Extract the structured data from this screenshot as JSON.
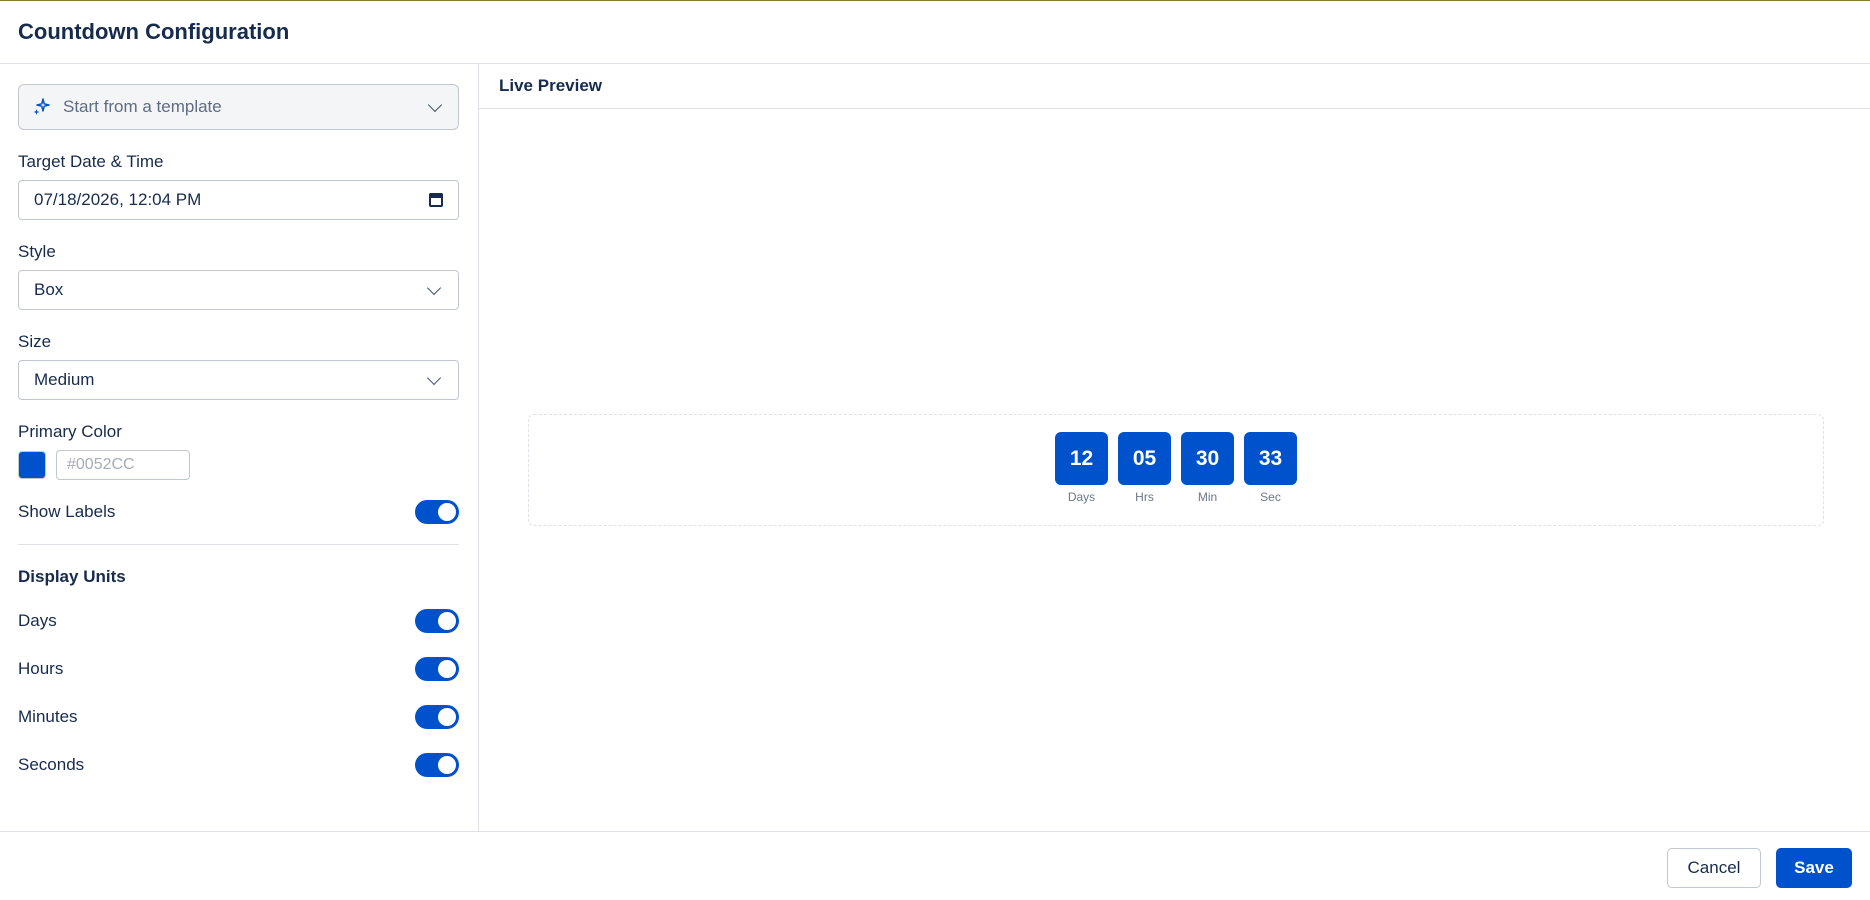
{
  "header": {
    "title": "Countdown Configuration"
  },
  "left": {
    "template_label": "Start from a template",
    "target_label": "Target Date & Time",
    "target_value": "07/18/2026, 12:04 PM",
    "style_label": "Style",
    "style_value": "Box",
    "size_label": "Size",
    "size_value": "Medium",
    "color_label": "Primary Color",
    "color_value": "#0052CC",
    "color_placeholder": "#0052CC",
    "show_labels": "Show Labels",
    "display_units_title": "Display Units",
    "units": [
      {
        "label": "Days",
        "enabled": true
      },
      {
        "label": "Hours",
        "enabled": true
      },
      {
        "label": "Minutes",
        "enabled": true
      },
      {
        "label": "Seconds",
        "enabled": true
      }
    ]
  },
  "preview": {
    "title": "Live Preview",
    "units": [
      {
        "value": "12",
        "label": "Days"
      },
      {
        "value": "05",
        "label": "Hrs"
      },
      {
        "value": "30",
        "label": "Min"
      },
      {
        "value": "33",
        "label": "Sec"
      }
    ]
  },
  "footer": {
    "cancel_label": "Cancel",
    "save_label": "Save"
  },
  "colors": {
    "primary": "#0052CC",
    "border": "#dfe1e6",
    "text": "#172b4d"
  },
  "icons": {
    "template": "sparkle-icon",
    "calendar": "calendar-icon",
    "chevron": "chevron-down-icon"
  }
}
